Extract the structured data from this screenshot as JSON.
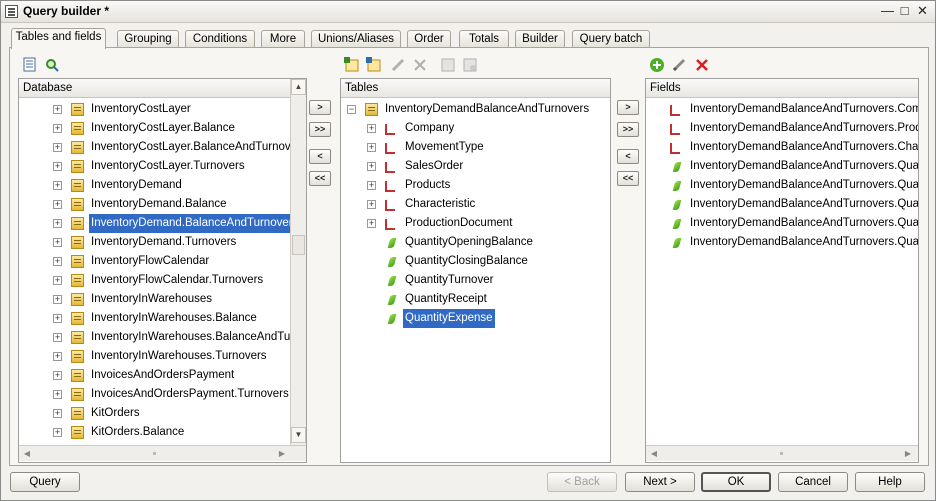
{
  "window": {
    "title": "Query builder *"
  },
  "tabs": [
    {
      "label": "Tables and fields"
    },
    {
      "label": "Grouping"
    },
    {
      "label": "Conditions"
    },
    {
      "label": "More"
    },
    {
      "label": "Unions/Aliases"
    },
    {
      "label": "Order"
    },
    {
      "label": "Totals"
    },
    {
      "label": "Builder"
    },
    {
      "label": "Query batch"
    }
  ],
  "database": {
    "header": "Database",
    "items": [
      {
        "label": "InventoryCostLayer"
      },
      {
        "label": "InventoryCostLayer.Balance"
      },
      {
        "label": "InventoryCostLayer.BalanceAndTurnovers"
      },
      {
        "label": "InventoryCostLayer.Turnovers"
      },
      {
        "label": "InventoryDemand"
      },
      {
        "label": "InventoryDemand.Balance"
      },
      {
        "label": "InventoryDemand.BalanceAndTurnovers",
        "selected": true
      },
      {
        "label": "InventoryDemand.Turnovers"
      },
      {
        "label": "InventoryFlowCalendar"
      },
      {
        "label": "InventoryFlowCalendar.Turnovers"
      },
      {
        "label": "InventoryInWarehouses"
      },
      {
        "label": "InventoryInWarehouses.Balance"
      },
      {
        "label": "InventoryInWarehouses.BalanceAndTurnov"
      },
      {
        "label": "InventoryInWarehouses.Turnovers"
      },
      {
        "label": "InvoicesAndOrdersPayment"
      },
      {
        "label": "InvoicesAndOrdersPayment.Turnovers"
      },
      {
        "label": "KitOrders"
      },
      {
        "label": "KitOrders.Balance"
      }
    ]
  },
  "transfer_buttons": {
    "add": ">",
    "add_all": ">>",
    "remove": "<",
    "remove_all": "<<"
  },
  "tables": {
    "header": "Tables",
    "root": "InventoryDemandBalanceAndTurnovers",
    "children": [
      {
        "label": "Company",
        "kind": "ref"
      },
      {
        "label": "MovementType",
        "kind": "ref"
      },
      {
        "label": "SalesOrder",
        "kind": "ref"
      },
      {
        "label": "Products",
        "kind": "ref"
      },
      {
        "label": "Characteristic",
        "kind": "ref"
      },
      {
        "label": "ProductionDocument",
        "kind": "ref"
      },
      {
        "label": "QuantityOpeningBalance",
        "kind": "field"
      },
      {
        "label": "QuantityClosingBalance",
        "kind": "field"
      },
      {
        "label": "QuantityTurnover",
        "kind": "field"
      },
      {
        "label": "QuantityReceipt",
        "kind": "field"
      },
      {
        "label": "QuantityExpense",
        "kind": "field",
        "selected": true
      }
    ]
  },
  "fields": {
    "header": "Fields",
    "items": [
      {
        "label": "InventoryDemandBalanceAndTurnovers.Company",
        "kind": "ref"
      },
      {
        "label": "InventoryDemandBalanceAndTurnovers.Products",
        "kind": "ref"
      },
      {
        "label": "InventoryDemandBalanceAndTurnovers.Characteristic",
        "kind": "ref"
      },
      {
        "label": "InventoryDemandBalanceAndTurnovers.QuantityOpeningBalance",
        "kind": "field"
      },
      {
        "label": "InventoryDemandBalanceAndTurnovers.QuantityClosingBalance",
        "kind": "field"
      },
      {
        "label": "InventoryDemandBalanceAndTurnovers.QuantityTurnover",
        "kind": "field"
      },
      {
        "label": "InventoryDemandBalanceAndTurnovers.QuantityReceipt",
        "kind": "field"
      },
      {
        "label": "InventoryDemandBalanceAndTurnovers.QuantityExpense",
        "kind": "field"
      }
    ]
  },
  "footer": {
    "query": "Query",
    "back": "< Back",
    "next": "Next >",
    "ok": "OK",
    "cancel": "Cancel",
    "help": "Help"
  }
}
